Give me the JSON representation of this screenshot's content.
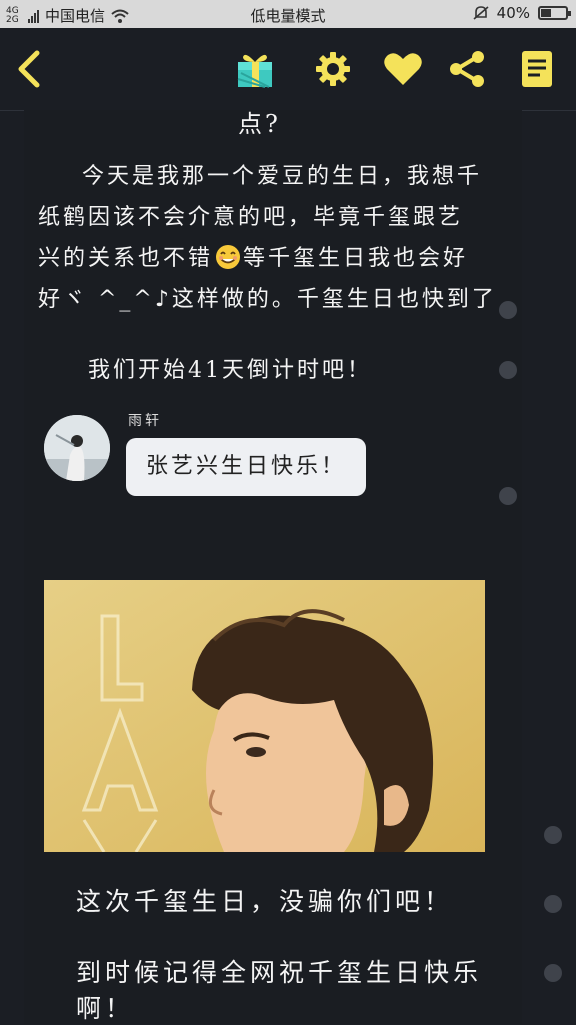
{
  "status_bar": {
    "network_top": "4G",
    "network_bottom": "2G",
    "carrier": "中国电信",
    "mode": "低电量模式",
    "battery": "40%",
    "battery_level": 0.4
  },
  "toolbar": {
    "icons": [
      "back-icon",
      "gift-icon",
      "settings-icon",
      "heart-icon",
      "share-icon",
      "notes-icon"
    ],
    "accent": "#f4e25a"
  },
  "article": {
    "title_tail": "点?",
    "para1_lines": [
      "今天是我那一个爱豆的生日，我想千",
      "纸鹤因该不会介意的吧，毕竟千玺跟艺",
      "兴的关系也不错",
      "等千玺生日我也会好",
      "好ヾ ^_^♪这样做的。千玺生日也快到了"
    ],
    "para2": "我们开始41天倒计时吧！",
    "message": {
      "sender": "雨轩",
      "text": "张艺兴生日快乐！"
    },
    "bottom_line1": "这次千玺生日，没骗你们吧！",
    "bottom_line2": "到时候记得全网祝千玺生日快乐啊！"
  }
}
